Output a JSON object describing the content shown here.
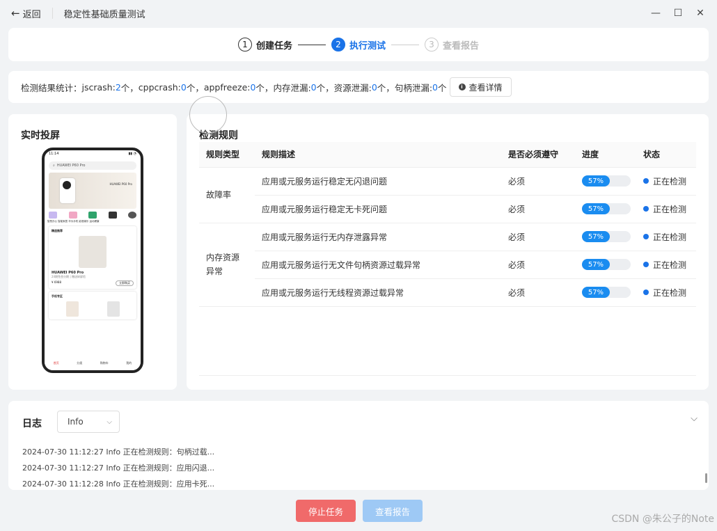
{
  "window": {
    "back_label": "返回",
    "title": "稳定性基础质量测试"
  },
  "steps": [
    {
      "num": "1",
      "label": "创建任务"
    },
    {
      "num": "2",
      "label": "执行测试"
    },
    {
      "num": "3",
      "label": "查看报告"
    }
  ],
  "stats": {
    "prefix": "检测结果统计：",
    "items": [
      {
        "label": "jscrash: ",
        "value": "2",
        "unit": "个，"
      },
      {
        "label": "cppcrash: ",
        "value": "0",
        "unit": "个，"
      },
      {
        "label": "appfreeze: ",
        "value": "0",
        "unit": "个，"
      },
      {
        "label": "内存泄漏: ",
        "value": "0",
        "unit": "个，"
      },
      {
        "label": "资源泄漏: ",
        "value": "0",
        "unit": "个，"
      },
      {
        "label": "句柄泄漏: ",
        "value": "0",
        "unit": "个"
      }
    ],
    "detail_button": "查看详情"
  },
  "screen": {
    "title": "实时投屏",
    "phone": {
      "time": "11:14",
      "search_placeholder": "HUAWEI P60 Pro",
      "banner_text": "HUAWEI P60 Pro",
      "icon_labels": "智慧办公 智能家居 华为手机 影音娱乐 运动健康",
      "section1": "精选推荐",
      "product_name": "HUAWEI P60 Pro",
      "product_desc": "24期免息分期 | 赠送碎屏险",
      "product_price": "¥ 6988",
      "product_btn": "立即购买",
      "section2": "手机专区",
      "nav": [
        "首页",
        "分类",
        "购物车",
        "我的"
      ]
    }
  },
  "rules": {
    "title": "检测规则",
    "columns": [
      "规则类型",
      "规则描述",
      "是否必须遵守",
      "进度",
      "状态"
    ],
    "groups": [
      {
        "type": "故障率",
        "rows": [
          {
            "desc": "应用或元服务运行稳定无闪退问题",
            "required": "必须",
            "progress": 0.57,
            "progress_label": "57%",
            "status": "正在检测"
          },
          {
            "desc": "应用或元服务运行稳定无卡死问题",
            "required": "必须",
            "progress": 0.57,
            "progress_label": "57%",
            "status": "正在检测"
          }
        ]
      },
      {
        "type": "内存资源异常",
        "rows": [
          {
            "desc": "应用或元服务运行无内存泄露异常",
            "required": "必须",
            "progress": 0.57,
            "progress_label": "57%",
            "status": "正在检测"
          },
          {
            "desc": "应用或元服务运行无文件句柄资源过载异常",
            "required": "必须",
            "progress": 0.57,
            "progress_label": "57%",
            "status": "正在检测"
          },
          {
            "desc": "应用或元服务运行无线程资源过载异常",
            "required": "必须",
            "progress": 0.57,
            "progress_label": "57%",
            "status": "正在检测"
          }
        ]
      }
    ]
  },
  "log": {
    "title": "日志",
    "level_selected": "Info",
    "lines": [
      "2024-07-30 11:12:27 Info 正在检测规则：句柄过载...",
      "2024-07-30 11:12:27 Info 正在检测规则：应用闪退...",
      "2024-07-30 11:12:28 Info 正在检测规则：应用卡死..."
    ]
  },
  "actions": {
    "stop": "停止任务",
    "report": "查看报告"
  },
  "watermark": "CSDN @朱公子的Note",
  "colors": {
    "accent": "#1a73e8",
    "danger": "#f06a6a",
    "disabled_primary": "#9ec9f5"
  }
}
